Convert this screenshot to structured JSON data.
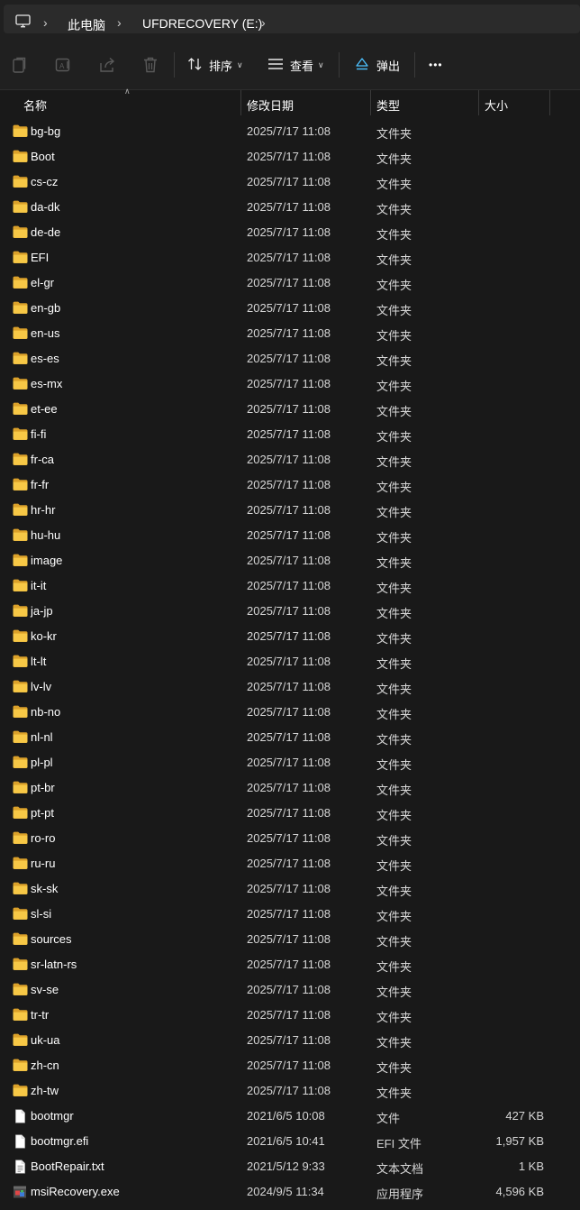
{
  "breadcrumb": {
    "items": [
      "此电脑",
      "UFDRECOVERY (E:)"
    ]
  },
  "toolbar": {
    "sort_label": "排序",
    "view_label": "查看",
    "eject_label": "弹出",
    "more_label": "•••"
  },
  "columns": {
    "name": "名称",
    "date": "修改日期",
    "type": "类型",
    "size": "大小"
  },
  "files": [
    {
      "name": "bg-bg",
      "date": "2025/7/17 11:08",
      "type": "文件夹",
      "size": "",
      "icon": "folder-icon"
    },
    {
      "name": "Boot",
      "date": "2025/7/17 11:08",
      "type": "文件夹",
      "size": "",
      "icon": "folder-icon"
    },
    {
      "name": "cs-cz",
      "date": "2025/7/17 11:08",
      "type": "文件夹",
      "size": "",
      "icon": "folder-icon"
    },
    {
      "name": "da-dk",
      "date": "2025/7/17 11:08",
      "type": "文件夹",
      "size": "",
      "icon": "folder-icon"
    },
    {
      "name": "de-de",
      "date": "2025/7/17 11:08",
      "type": "文件夹",
      "size": "",
      "icon": "folder-icon"
    },
    {
      "name": "EFI",
      "date": "2025/7/17 11:08",
      "type": "文件夹",
      "size": "",
      "icon": "folder-icon"
    },
    {
      "name": "el-gr",
      "date": "2025/7/17 11:08",
      "type": "文件夹",
      "size": "",
      "icon": "folder-icon"
    },
    {
      "name": "en-gb",
      "date": "2025/7/17 11:08",
      "type": "文件夹",
      "size": "",
      "icon": "folder-icon"
    },
    {
      "name": "en-us",
      "date": "2025/7/17 11:08",
      "type": "文件夹",
      "size": "",
      "icon": "folder-icon"
    },
    {
      "name": "es-es",
      "date": "2025/7/17 11:08",
      "type": "文件夹",
      "size": "",
      "icon": "folder-icon"
    },
    {
      "name": "es-mx",
      "date": "2025/7/17 11:08",
      "type": "文件夹",
      "size": "",
      "icon": "folder-icon"
    },
    {
      "name": "et-ee",
      "date": "2025/7/17 11:08",
      "type": "文件夹",
      "size": "",
      "icon": "folder-icon"
    },
    {
      "name": "fi-fi",
      "date": "2025/7/17 11:08",
      "type": "文件夹",
      "size": "",
      "icon": "folder-icon"
    },
    {
      "name": "fr-ca",
      "date": "2025/7/17 11:08",
      "type": "文件夹",
      "size": "",
      "icon": "folder-icon"
    },
    {
      "name": "fr-fr",
      "date": "2025/7/17 11:08",
      "type": "文件夹",
      "size": "",
      "icon": "folder-icon"
    },
    {
      "name": "hr-hr",
      "date": "2025/7/17 11:08",
      "type": "文件夹",
      "size": "",
      "icon": "folder-icon"
    },
    {
      "name": "hu-hu",
      "date": "2025/7/17 11:08",
      "type": "文件夹",
      "size": "",
      "icon": "folder-icon"
    },
    {
      "name": "image",
      "date": "2025/7/17 11:08",
      "type": "文件夹",
      "size": "",
      "icon": "folder-icon"
    },
    {
      "name": "it-it",
      "date": "2025/7/17 11:08",
      "type": "文件夹",
      "size": "",
      "icon": "folder-icon"
    },
    {
      "name": "ja-jp",
      "date": "2025/7/17 11:08",
      "type": "文件夹",
      "size": "",
      "icon": "folder-icon"
    },
    {
      "name": "ko-kr",
      "date": "2025/7/17 11:08",
      "type": "文件夹",
      "size": "",
      "icon": "folder-icon"
    },
    {
      "name": "lt-lt",
      "date": "2025/7/17 11:08",
      "type": "文件夹",
      "size": "",
      "icon": "folder-icon"
    },
    {
      "name": "lv-lv",
      "date": "2025/7/17 11:08",
      "type": "文件夹",
      "size": "",
      "icon": "folder-icon"
    },
    {
      "name": "nb-no",
      "date": "2025/7/17 11:08",
      "type": "文件夹",
      "size": "",
      "icon": "folder-icon"
    },
    {
      "name": "nl-nl",
      "date": "2025/7/17 11:08",
      "type": "文件夹",
      "size": "",
      "icon": "folder-icon"
    },
    {
      "name": "pl-pl",
      "date": "2025/7/17 11:08",
      "type": "文件夹",
      "size": "",
      "icon": "folder-icon"
    },
    {
      "name": "pt-br",
      "date": "2025/7/17 11:08",
      "type": "文件夹",
      "size": "",
      "icon": "folder-icon"
    },
    {
      "name": "pt-pt",
      "date": "2025/7/17 11:08",
      "type": "文件夹",
      "size": "",
      "icon": "folder-icon"
    },
    {
      "name": "ro-ro",
      "date": "2025/7/17 11:08",
      "type": "文件夹",
      "size": "",
      "icon": "folder-icon"
    },
    {
      "name": "ru-ru",
      "date": "2025/7/17 11:08",
      "type": "文件夹",
      "size": "",
      "icon": "folder-icon"
    },
    {
      "name": "sk-sk",
      "date": "2025/7/17 11:08",
      "type": "文件夹",
      "size": "",
      "icon": "folder-icon"
    },
    {
      "name": "sl-si",
      "date": "2025/7/17 11:08",
      "type": "文件夹",
      "size": "",
      "icon": "folder-icon"
    },
    {
      "name": "sources",
      "date": "2025/7/17 11:08",
      "type": "文件夹",
      "size": "",
      "icon": "folder-icon"
    },
    {
      "name": "sr-latn-rs",
      "date": "2025/7/17 11:08",
      "type": "文件夹",
      "size": "",
      "icon": "folder-icon"
    },
    {
      "name": "sv-se",
      "date": "2025/7/17 11:08",
      "type": "文件夹",
      "size": "",
      "icon": "folder-icon"
    },
    {
      "name": "tr-tr",
      "date": "2025/7/17 11:08",
      "type": "文件夹",
      "size": "",
      "icon": "folder-icon"
    },
    {
      "name": "uk-ua",
      "date": "2025/7/17 11:08",
      "type": "文件夹",
      "size": "",
      "icon": "folder-icon"
    },
    {
      "name": "zh-cn",
      "date": "2025/7/17 11:08",
      "type": "文件夹",
      "size": "",
      "icon": "folder-icon"
    },
    {
      "name": "zh-tw",
      "date": "2025/7/17 11:08",
      "type": "文件夹",
      "size": "",
      "icon": "folder-icon"
    },
    {
      "name": "bootmgr",
      "date": "2021/6/5 10:08",
      "type": "文件",
      "size": "427 KB",
      "icon": "file-icon"
    },
    {
      "name": "bootmgr.efi",
      "date": "2021/6/5 10:41",
      "type": "EFI 文件",
      "size": "1,957 KB",
      "icon": "file-icon"
    },
    {
      "name": "BootRepair.txt",
      "date": "2021/5/12 9:33",
      "type": "文本文档",
      "size": "1 KB",
      "icon": "text-file-icon"
    },
    {
      "name": "msiRecovery.exe",
      "date": "2024/9/5 11:34",
      "type": "应用程序",
      "size": "4,596 KB",
      "icon": "app-icon"
    }
  ],
  "colors": {
    "background": "#191919",
    "toolbar": "#202020",
    "folder": "#f7c846",
    "eject_accent": "#4cc2ff"
  }
}
